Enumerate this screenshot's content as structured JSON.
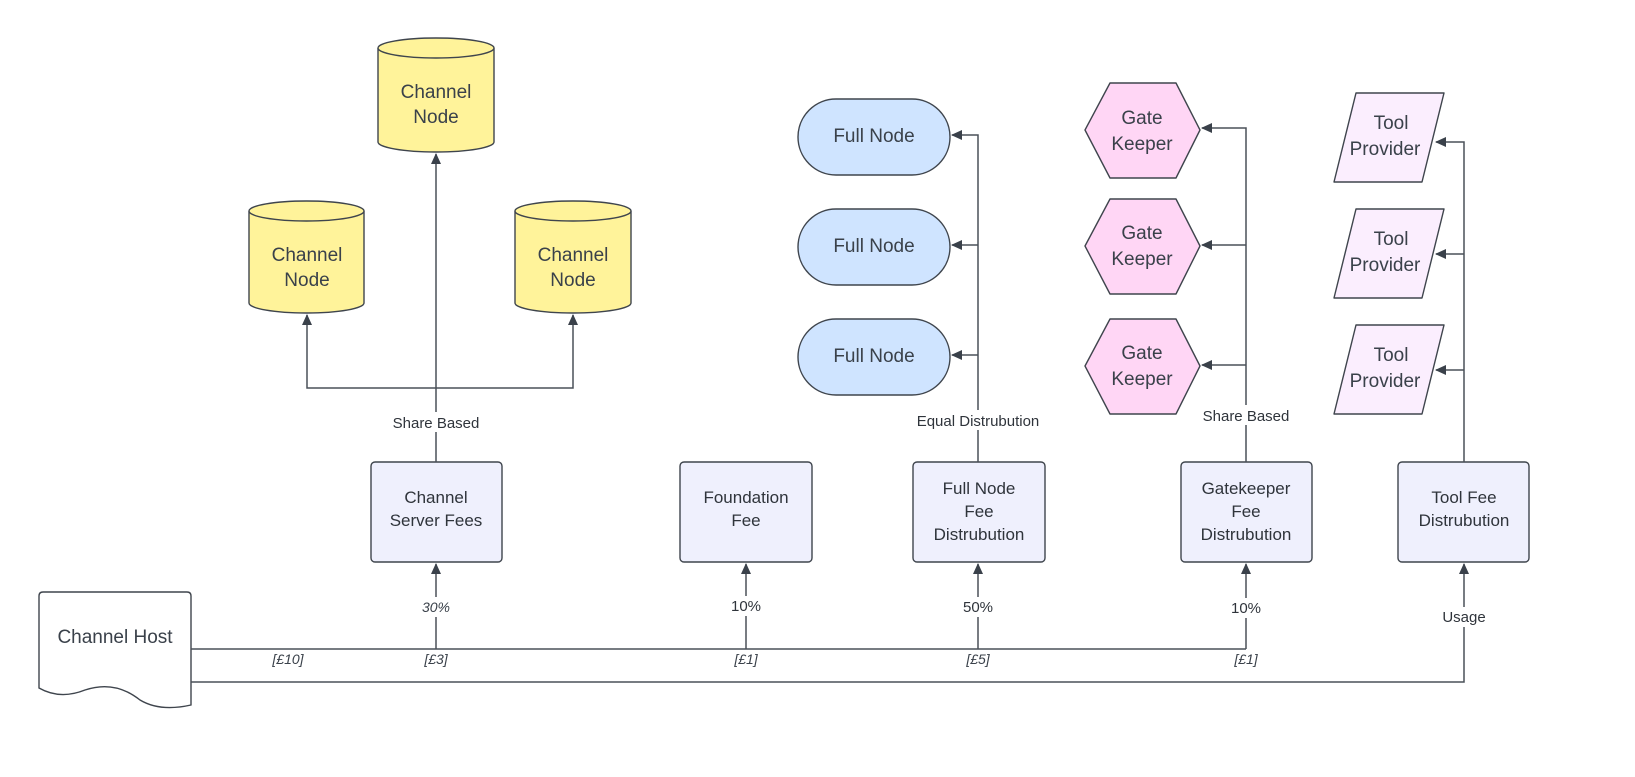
{
  "nodes": {
    "channel_node": [
      "Channel",
      "Node"
    ],
    "full_node": "Full Node",
    "gate_keeper": [
      "Gate",
      "Keeper"
    ],
    "tool_provider": [
      "Tool",
      "Provider"
    ],
    "channel_host": "Channel Host"
  },
  "boxes": {
    "channel_server_fees": [
      "Channel",
      "Server Fees"
    ],
    "foundation_fee": [
      "Foundation",
      "Fee"
    ],
    "full_node_fee": [
      "Full Node",
      "Fee",
      "Distrubution"
    ],
    "gatekeeper_fee": [
      "Gatekeeper",
      "Fee",
      "Distrubution"
    ],
    "tool_fee": [
      "Tool Fee",
      "Distrubution"
    ]
  },
  "labels": {
    "share_based_channel": "Share Based",
    "equal_distribution": "Equal Distrubution",
    "share_based_gatekeeper": "Share Based",
    "pct_channel": "30%",
    "pct_foundation": "10%",
    "pct_full_node": "50%",
    "pct_gatekeeper": "10%",
    "usage": "Usage",
    "amt_total": "[£10]",
    "amt_channel": "[£3]",
    "amt_foundation": "[£1]",
    "amt_full_node": "[£5]",
    "amt_gatekeeper": "[£1]"
  },
  "colors": {
    "channel_node": "#fff39a",
    "full_node": "#cfe4ff",
    "gate_keeper": "#ffd6f5",
    "tool_provider": "#fbeefe",
    "fee_box": "#eff0fd"
  }
}
